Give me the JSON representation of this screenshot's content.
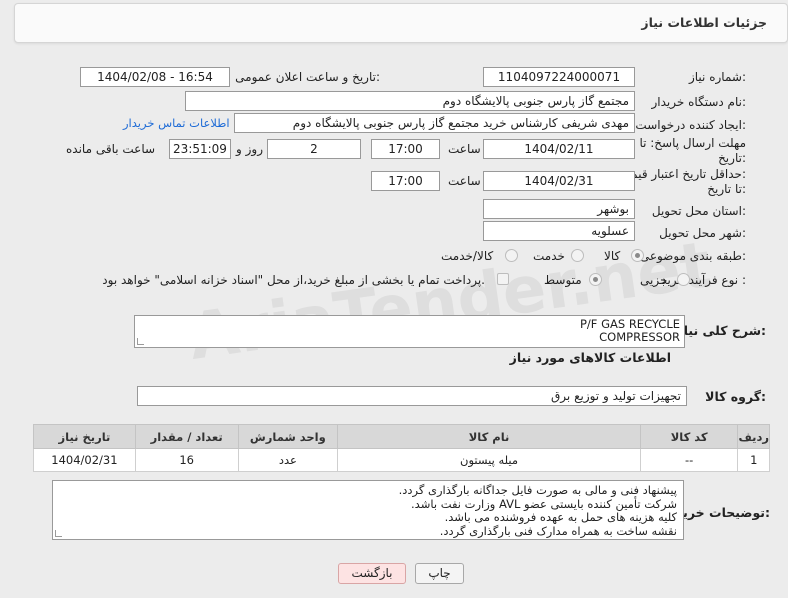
{
  "header": {
    "title": "جزئیات اطلاعات نیاز"
  },
  "fields": {
    "need_number_label": "شماره نیاز:",
    "need_number": "1104097224000071",
    "announce_label": "تاریخ و ساعت اعلان عمومی:",
    "announce_value": "1404/02/08 - 16:54",
    "buyer_org_label": "نام دستگاه خریدار:",
    "buyer_org": "مجتمع گاز پارس جنوبی  پالایشگاه دوم",
    "requester_label": "ایجاد کننده درخواست:",
    "requester": "مهدی شریفی کارشناس خرید مجتمع گاز پارس جنوبی  پالایشگاه دوم",
    "contact_link": "اطلاعات تماس خریدار",
    "deadline_label_1": "مهلت ارسال پاسخ: تا",
    "deadline_label_2": "تاریخ:",
    "deadline_date": "1404/02/11",
    "time_label": "ساعت",
    "deadline_time": "17:00",
    "days_value": "2",
    "days_label": "روز و",
    "remaining_time": "23:51:09",
    "remaining_label": "ساعت باقی مانده",
    "validity_label_1": "حداقل تاریخ اعتبار قیمت:",
    "validity_label_2": "تا تاریخ:",
    "validity_date": "1404/02/31",
    "validity_time_label": "ساعت",
    "validity_time": "17:00",
    "province_label": "استان محل تحویل:",
    "province": "بوشهر",
    "city_label": "شهر محل تحویل:",
    "city": "عسلویه",
    "category_label": "طبقه بندی موضوعی:",
    "category_options": [
      "کالا",
      "خدمت",
      "کالا/خدمت"
    ],
    "category_selected": "کالا",
    "process_label": "نوع فرآیند خرید :",
    "process_options": [
      "جزیی",
      "متوسط"
    ],
    "process_selected": "متوسط",
    "payment_note": "پرداخت تمام یا بخشی از مبلغ خرید،از محل \"اسناد خزانه اسلامی\" خواهد بود."
  },
  "summary": {
    "label": "شرح کلی نیاز:",
    "line1": "P/F GAS RECYCLE",
    "line2": "COMPRESSOR"
  },
  "goods_section": {
    "title": "اطلاعات کالاهای مورد نیاز",
    "group_label": "گروه کالا:",
    "group_value": "تجهیزات تولید و توزیع برق"
  },
  "table": {
    "headers": [
      "ردیف",
      "کد کالا",
      "نام کالا",
      "واحد شمارش",
      "تعداد / مقدار",
      "تاریخ نیاز"
    ],
    "rows": [
      [
        "1",
        "--",
        "میله پیستون",
        "عدد",
        "16",
        "1404/02/31"
      ]
    ]
  },
  "buyer_notes": {
    "label": "توضیحات خریدار:",
    "lines": [
      "پیشنهاد فنی و مالی به صورت فایل جداگانه بارگذاری گردد.",
      "شرکت تأمین کننده بایستی عضو AVL وزارت نفت باشد.",
      "کلیه هزینه های حمل به عهده فروشنده می باشد.",
      "نقشه ساخت به همراه مدارک فنی بارگذاری گردد."
    ]
  },
  "buttons": {
    "print": "چاپ",
    "back": "بازگشت"
  },
  "watermark": "AriaTender.net",
  "colors": {
    "link": "#1e6bd6",
    "back_button_bg": "#fde3e3",
    "print_button_bg": "#f4f4f4"
  }
}
